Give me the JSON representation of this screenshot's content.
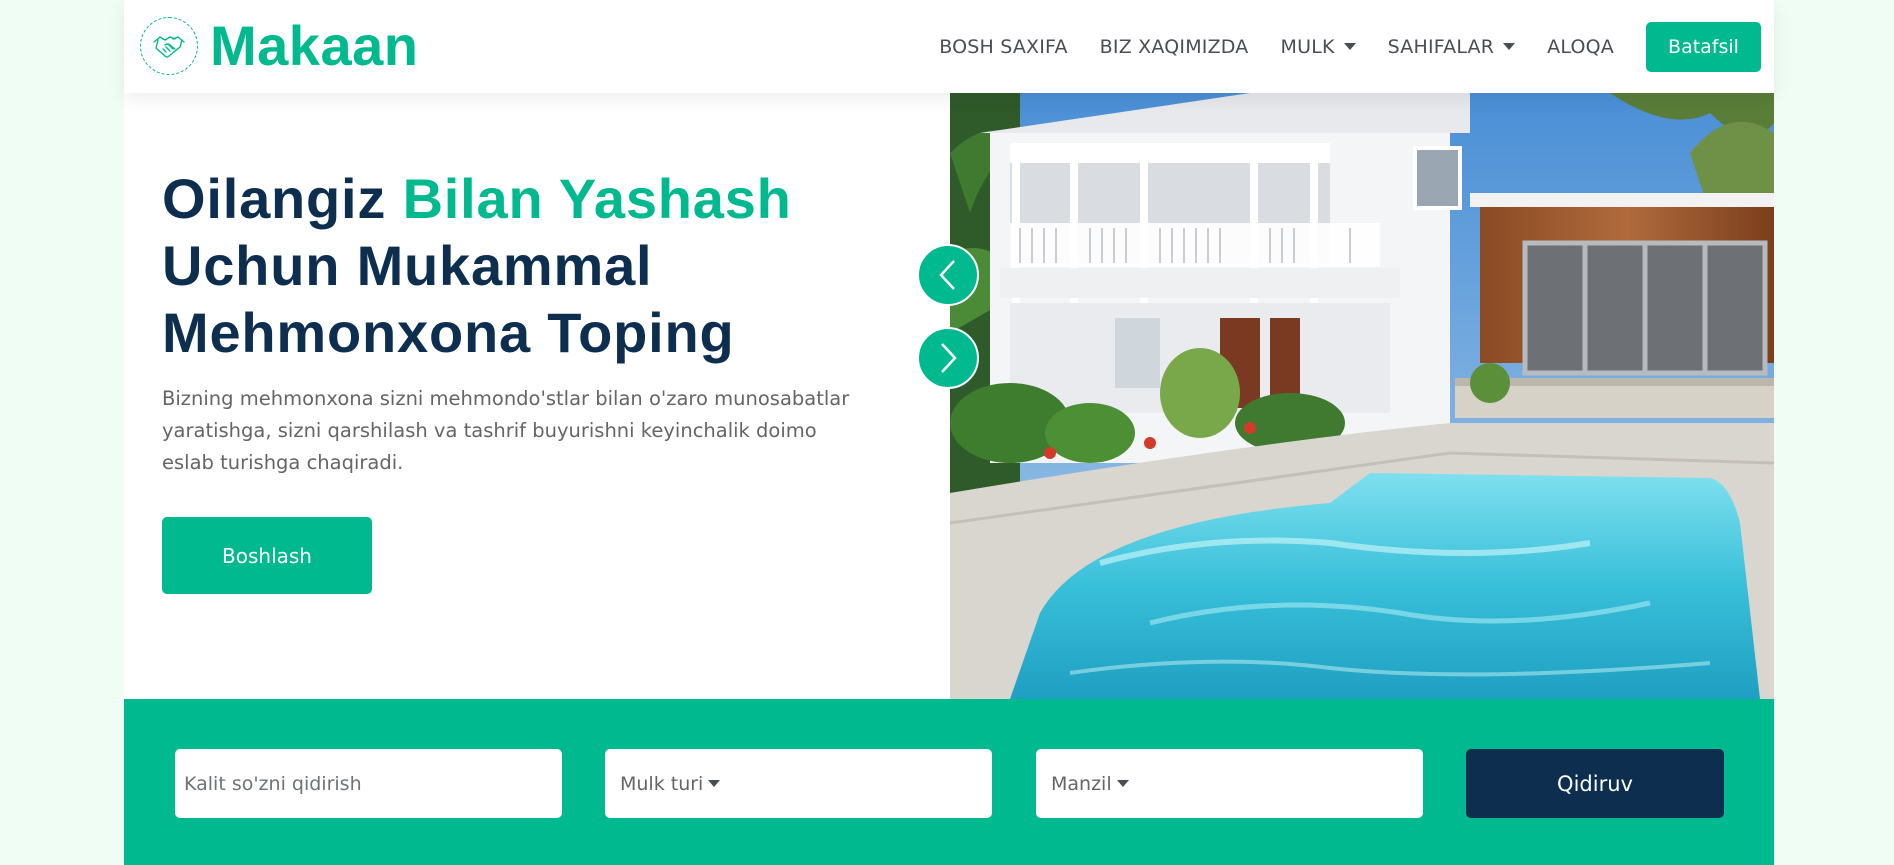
{
  "brand": {
    "name": "Makaan",
    "icon": "handshake-icon"
  },
  "nav": {
    "items": [
      {
        "label": "BOSH SAXIFA",
        "dropdown": false
      },
      {
        "label": "BIZ XAQIMIZDA",
        "dropdown": false
      },
      {
        "label": "MULK",
        "dropdown": true
      },
      {
        "label": "SAHIFALAR",
        "dropdown": true
      },
      {
        "label": "ALOQA",
        "dropdown": false
      }
    ],
    "cta": "Batafsil"
  },
  "hero": {
    "title_part1": "Oilangiz ",
    "title_accent": "Bilan Yashash",
    "title_part2": "Uchun Mukammal Mehmonxona Toping",
    "description": "Bizning mehmonxona sizni mehmondo'stlar bilan o'zaro munosabatlar yaratishga, sizni qarshilash va tashrif buyurishni keyinchalik doimo eslab turishga chaqiradi.",
    "button": "Boshlash",
    "image": "house-with-pool-photo"
  },
  "carousel": {
    "prev_icon": "chevron-left-icon",
    "next_icon": "chevron-right-icon"
  },
  "search": {
    "keyword_placeholder": "Kalit so'zni qidirish",
    "property_type": "Mulk turi",
    "location": "Manzil",
    "button": "Qidiruv"
  },
  "colors": {
    "primary": "#00b98e",
    "dark": "#0e2e50",
    "text": "#666565",
    "page_bg": "#effdf5"
  }
}
